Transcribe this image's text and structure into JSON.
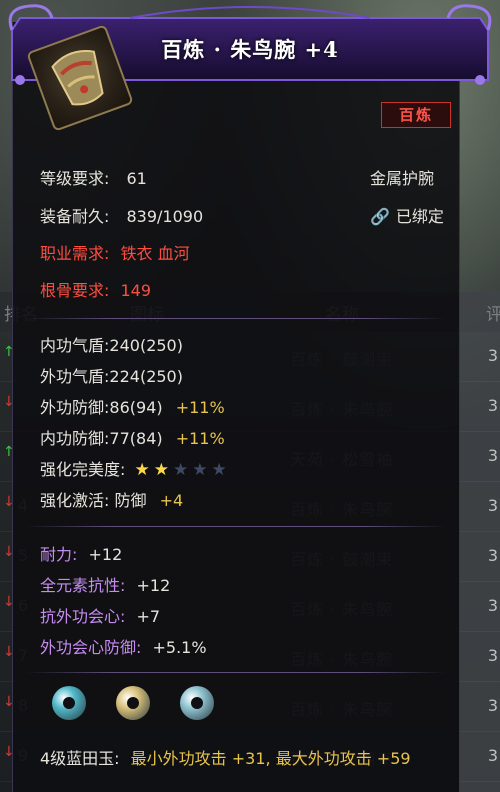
{
  "background": {
    "columns": [
      "排名",
      "图标",
      "名称",
      "评"
    ],
    "rows": [
      {
        "rank": "",
        "arrow": "up",
        "name": "百炼 · 鼓潮束",
        "num": "3"
      },
      {
        "rank": "",
        "arrow": "down",
        "name": "百炼 · 朱鸟腕",
        "num": "3"
      },
      {
        "rank": "",
        "arrow": "up",
        "name": "天苑 · 松雪袖",
        "num": "3"
      },
      {
        "rank": "4",
        "arrow": "down",
        "name": "百炼 · 朱鸟腕",
        "num": "3"
      },
      {
        "rank": "5",
        "arrow": "down",
        "name": "百炼 · 鼓潮束",
        "num": "3"
      },
      {
        "rank": "6",
        "arrow": "down",
        "name": "百炼 · 朱鸟腕",
        "num": "3"
      },
      {
        "rank": "7",
        "arrow": "down",
        "name": "百炼 · 朱鸟腕",
        "num": "3"
      },
      {
        "rank": "8",
        "arrow": "down",
        "name": "百炼 · 朱鸟腕",
        "num": "3"
      },
      {
        "rank": "9",
        "arrow": "down",
        "name": "百炼 · 鼓潮束",
        "num": "3"
      }
    ]
  },
  "tooltip": {
    "title": "百炼 · 朱鸟腕  +4",
    "quality_badge": "百炼",
    "item_icon": "bracer-icon",
    "level_req_label": "等级要求:",
    "level_req_value": "61",
    "item_type": "金属护腕",
    "durability_label": "装备耐久:",
    "durability_value": "839/1090",
    "bind_status": "已绑定",
    "bind_icon": "lock-icon",
    "class_req_label": "职业需求:",
    "class_req_value": "铁衣 血河",
    "bone_req_label": "根骨要求:",
    "bone_req_value": "149",
    "stats": [
      {
        "label": "内功气盾:",
        "value": "240(250)",
        "bonus": ""
      },
      {
        "label": "外功气盾:",
        "value": "224(250)",
        "bonus": ""
      },
      {
        "label": "外功防御:",
        "value": "86(94)",
        "bonus": "+11%"
      },
      {
        "label": "内功防御:",
        "value": "77(84)",
        "bonus": "+11%"
      }
    ],
    "refine_label": "强化完美度:",
    "refine_stars": {
      "filled": 2,
      "total": 5
    },
    "activation_label": "强化激活:",
    "activation_value": "防御",
    "activation_bonus": "+4",
    "extra_stats": [
      {
        "label": "耐力:",
        "value": "+12"
      },
      {
        "label": "全元素抗性:",
        "value": "+12"
      },
      {
        "label": "抗外功会心:",
        "value": "+7"
      },
      {
        "label": "外功会心防御:",
        "value": "+5.1%"
      }
    ],
    "gems": [
      {
        "icon": "jade-ring-icon",
        "color": "#4fb7c8"
      },
      {
        "icon": "gold-disc-icon",
        "color": "#d7c079"
      },
      {
        "icon": "jade-ring-icon",
        "color": "#8ec2cf"
      }
    ],
    "gem_label": "4级蓝田玉:",
    "gem_effect": "最小外功攻击  +31, 最大外功攻击  +59"
  },
  "colors": {
    "quality_red": "#ff4d3f",
    "bonus_yellow": "#e8c34d",
    "purple_stat": "#c48cf0",
    "star_on": "#ffd84a"
  }
}
